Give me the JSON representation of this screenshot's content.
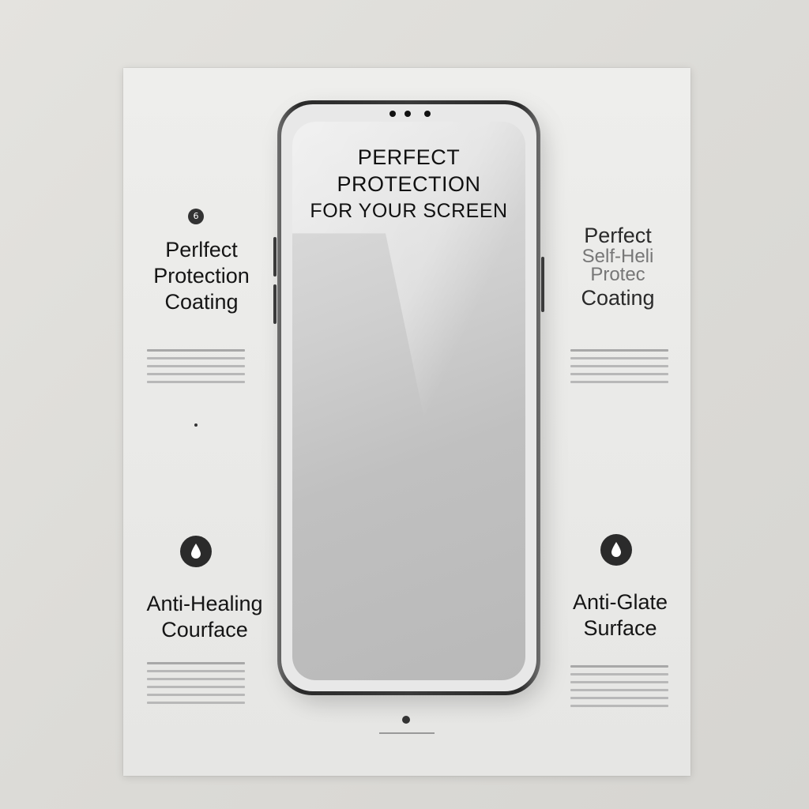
{
  "screen": {
    "title_line1": "PERFECT",
    "title_line2": "PROTECTION",
    "title_line3": "FOR YOUR SCREEN"
  },
  "features": [
    {
      "title_lines": [
        "Perlfect",
        "Protection",
        "Coating"
      ],
      "icon": "badge-icon"
    },
    {
      "title_lines": [
        "Perfect",
        "Self-Heli",
        "Protec",
        "Coating"
      ],
      "icon": "none"
    },
    {
      "title_lines": [
        "Anti-Healing",
        "Courface"
      ],
      "icon": "droplet-icon"
    },
    {
      "title_lines": [
        "Anti-Glate",
        "Surface"
      ],
      "icon": "droplet-icon"
    }
  ],
  "colors": {
    "background": "#dcdbd7",
    "sheet": "#ebebe9",
    "phone_frame": "#2f2f2f",
    "icon_bg": "#2b2b2b",
    "text": "#151515"
  }
}
